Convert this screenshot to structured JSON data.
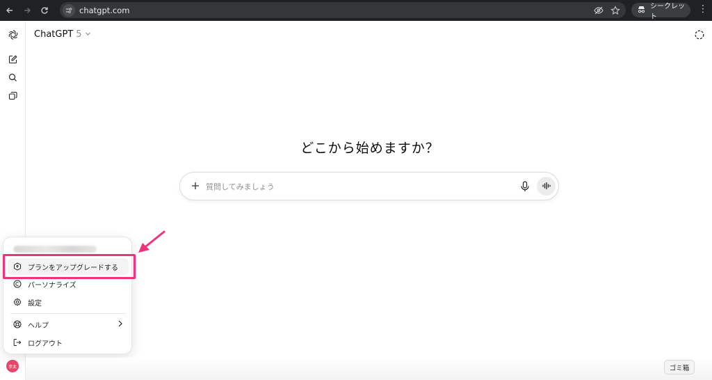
{
  "browser": {
    "url": "chatgpt.com",
    "incognito_label": "シークレット"
  },
  "header": {
    "model_name": "ChatGPT",
    "model_version": "5"
  },
  "main": {
    "headline": "どこから始めますか？",
    "composer": {
      "placeholder": "質問してみましょう",
      "value": ""
    }
  },
  "account_menu": {
    "items": [
      {
        "label": "プランをアップグレードする",
        "icon": "upgrade-icon"
      },
      {
        "label": "パーソナライズ",
        "icon": "personalize-icon"
      },
      {
        "label": "設定",
        "icon": "gear-icon"
      },
      {
        "label": "ヘルプ",
        "icon": "help-icon"
      },
      {
        "label": "ログアウト",
        "icon": "logout-icon"
      }
    ]
  },
  "user": {
    "avatar_text": "幸太"
  },
  "dock_tooltip": "ゴミ箱",
  "colors": {
    "accent_highlight": "#f0327d",
    "avatar_bg": "#e8456a",
    "chrome_bg": "#202124"
  }
}
